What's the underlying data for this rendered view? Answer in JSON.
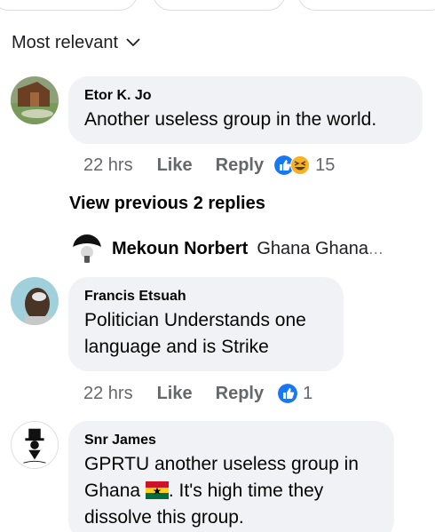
{
  "sort": {
    "label": "Most relevant"
  },
  "comments": [
    {
      "author": "Etor K. Jo",
      "text": "Another useless group in the world.",
      "time": "22 hrs",
      "like_label": "Like",
      "reply_label": "Reply",
      "reactions": [
        "like",
        "haha"
      ],
      "reaction_count": "15"
    },
    {
      "author": "Francis Etsuah",
      "text_line1": "Politician Understands one",
      "text_line2": "language and is Strike",
      "time": "22 hrs",
      "like_label": "Like",
      "reply_label": "Reply",
      "reactions": [
        "like"
      ],
      "reaction_count": "1"
    },
    {
      "author": "Snr James",
      "text_line1": "GPRTU another useless group in",
      "text_line2_pre": "Ghana ",
      "text_line2_post": ". It's high time they",
      "text_line3": "dissolve this group."
    }
  ],
  "replies": {
    "view_previous_label": "View previous 2 replies",
    "preview": {
      "name": "Mekoun Norbert",
      "snippet": "Ghana Ghana",
      "ellipsis": "..."
    }
  },
  "colors": {
    "bubble": "#f0f2f5",
    "muted": "#65676b",
    "like_blue": "#1877f2",
    "haha_yellow": "#f7b125"
  }
}
